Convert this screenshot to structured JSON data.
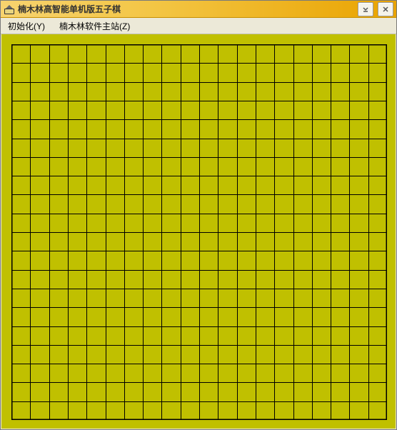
{
  "window": {
    "title": "楠木林高智能单机版五子棋"
  },
  "menu": {
    "init_label": "初始化(Y)",
    "site_label": "楠木林软件主站(Z)"
  },
  "board": {
    "grid_size": 20,
    "background_color": "#c0c000",
    "line_color": "#000000"
  },
  "icons": {
    "app_icon_name": "app-icon",
    "minimize_name": "minimize-icon",
    "close_name": "close-icon"
  }
}
